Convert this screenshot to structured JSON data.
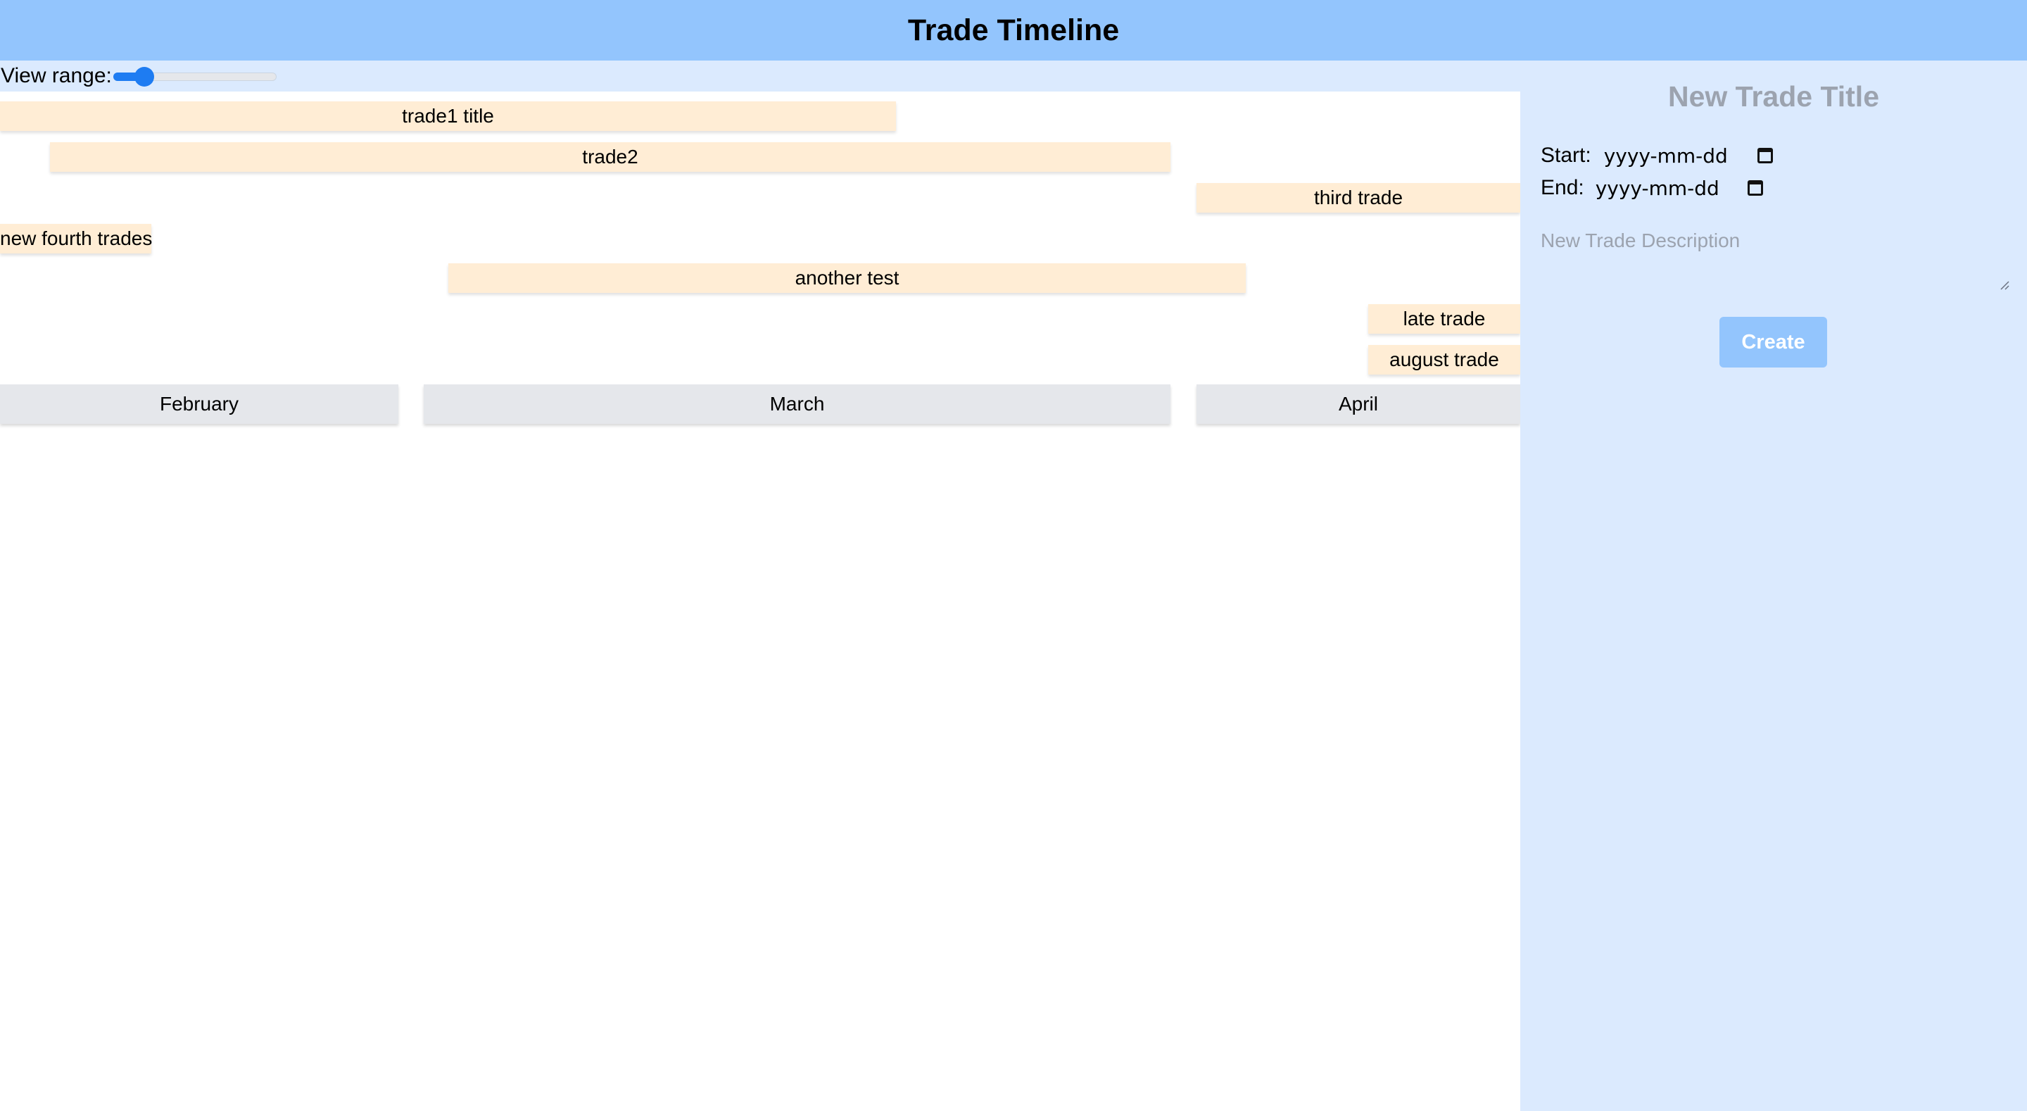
{
  "header": {
    "title": "Trade Timeline"
  },
  "toolbar": {
    "view_range_label": "View range:",
    "view_range_value": 0.15
  },
  "trades": [
    {
      "title": "trade1 title"
    },
    {
      "title": "trade2"
    },
    {
      "title": "third trade"
    },
    {
      "title": "new fourth trades"
    },
    {
      "title": "another test"
    },
    {
      "title": "late trade"
    },
    {
      "title": "august trade"
    }
  ],
  "months": [
    "February",
    "March",
    "April"
  ],
  "form": {
    "title_placeholder": "New Trade Title",
    "start_label": "Start:",
    "start_placeholder": "yyyy-mm-dd",
    "end_label": "End:",
    "end_placeholder": "yyyy-mm-dd",
    "description_placeholder": "New Trade Description",
    "create_label": "Create"
  },
  "icons": {
    "date_picker": "calendar-icon",
    "textarea_resize": "resize-handle-icon"
  },
  "colors": {
    "header_bg": "#93c5fd",
    "panel_bg": "#dbeafe",
    "trade_bar": "#ffedd5",
    "month_bar": "#e5e7eb",
    "slider_accent": "#1e7cf2",
    "button_bg": "#93c5fd"
  }
}
